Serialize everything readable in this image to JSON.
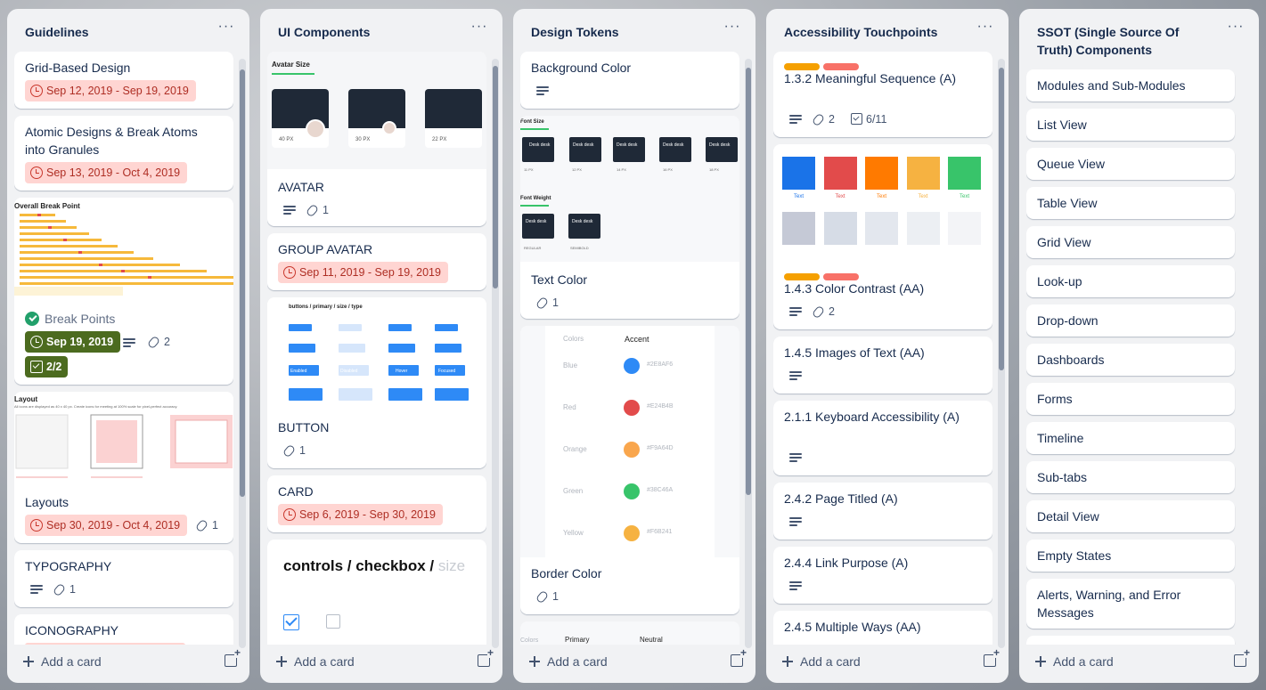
{
  "lists": [
    {
      "title": "Guidelines",
      "cards": [
        {
          "title": "Grid-Based Design",
          "date": "Sep 12, 2019 - Sep 19, 2019"
        },
        {
          "title": "Atomic Designs & Break Atoms into Granules",
          "date": "Sep 13, 2019 - Oct 4, 2019"
        },
        {
          "title": "Break Points",
          "date": "Sep 19, 2019",
          "attachments": "2",
          "checklist": "2/2",
          "cover_title": "Overall Break Point"
        },
        {
          "title": "Layouts",
          "date": "Sep 30, 2019 - Oct 4, 2019",
          "attachments": "1",
          "cover_title": "Layout",
          "cover_sub": "All icons are displayed as 40 x 40 px. Create icons for meeting at 100% scale for pixel-perfect accuracy."
        },
        {
          "title": "TYPOGRAPHY",
          "attachments": "1"
        },
        {
          "title": "ICONOGRAPHY"
        }
      ]
    },
    {
      "title": "UI Components",
      "cards": [
        {
          "title": "AVATAR",
          "attachments": "1",
          "cover_title": "Avatar Size",
          "cover_labels": [
            "40 PX",
            "30 PX",
            "22 PX"
          ]
        },
        {
          "title": "GROUP AVATAR",
          "date": "Sep 11, 2019 - Sep 19, 2019"
        },
        {
          "title": "BUTTON",
          "attachments": "1",
          "cover_title": "buttons / primary / size / type",
          "cover_buttons": [
            "Enabled",
            "Disabled",
            "Hover",
            "Focused"
          ]
        },
        {
          "title": "CARD",
          "date": "Sep 6, 2019 - Sep 30, 2019"
        },
        {
          "title_main": "controls / checkbox /",
          "title_faded": "size"
        }
      ]
    },
    {
      "title": "Design Tokens",
      "cards": [
        {
          "title": "Background Color"
        },
        {
          "title": "Text Color",
          "attachments": "1",
          "cover_title": "Font Size",
          "cover_title2": "Font Weight",
          "chips": [
            "Desk desk",
            "Desk desk",
            "Desk desk",
            "Desk desk",
            "Desk desk"
          ],
          "sizes": [
            "11 PX",
            "12 PX",
            "14 PX",
            "16 PX",
            "18 PX"
          ],
          "weights": [
            "REGULAR",
            "SEMIBOLD"
          ]
        },
        {
          "title": "Border Color",
          "attachments": "1",
          "colors_header": "Colors",
          "accent_header": "Accent",
          "swatches": [
            {
              "name": "Blue",
              "hex": "#2E8AF6",
              "color": "#2e8af6"
            },
            {
              "name": "Red",
              "hex": "#E24B4B",
              "color": "#e24b4b"
            },
            {
              "name": "Orange",
              "hex": "#F9A64D",
              "color": "#f9a64d"
            },
            {
              "name": "Green",
              "hex": "#38C46A",
              "color": "#38c46a"
            },
            {
              "name": "Yellow",
              "hex": "#F6B241",
              "color": "#f6b241"
            }
          ]
        },
        {
          "cover_cols": [
            "Colors",
            "Primary",
            "Neutral"
          ]
        }
      ]
    },
    {
      "title": "Accessibility Touchpoints",
      "label_colors": [
        "#f5a000",
        "#f87168"
      ],
      "cards": [
        {
          "title": "1.3.2 Meaningful Sequence (A)",
          "attachments": "2",
          "checklist": "6/11"
        },
        {
          "title": "1.4.3 Color Contrast (AA)",
          "attachments": "2",
          "palette": [
            "#1a73e8",
            "#e24b4b",
            "#ff7a00",
            "#f6b241",
            "#38c46a"
          ],
          "palette_light": [
            "#c5c9d6",
            "#d6dce6",
            "#e3e7ee",
            "#eceff3",
            "#f3f4f7"
          ],
          "palette_label": "Text"
        },
        {
          "title": "1.4.5 Images of Text (AA)"
        },
        {
          "title": "2.1.1 Keyboard Accessibility (A)"
        },
        {
          "title": "2.4.2 Page Titled (A)"
        },
        {
          "title": "2.4.4 Link Purpose (A)"
        },
        {
          "title": "2.4.5 Multiple Ways (AA)"
        }
      ]
    },
    {
      "title": "SSOT (Single Source Of Truth) Components",
      "cards": [
        {
          "title": "Modules and Sub-Modules"
        },
        {
          "title": "List View"
        },
        {
          "title": "Queue View"
        },
        {
          "title": "Table View"
        },
        {
          "title": "Grid View"
        },
        {
          "title": "Look-up"
        },
        {
          "title": "Drop-down"
        },
        {
          "title": "Dashboards"
        },
        {
          "title": "Forms"
        },
        {
          "title": "Timeline"
        },
        {
          "title": "Sub-tabs"
        },
        {
          "title": "Detail View"
        },
        {
          "title": "Empty States"
        },
        {
          "title": "Alerts, Warning, and Error Messages"
        }
      ]
    }
  ],
  "ui": {
    "add_card": "Add a card",
    "menu": "···"
  }
}
